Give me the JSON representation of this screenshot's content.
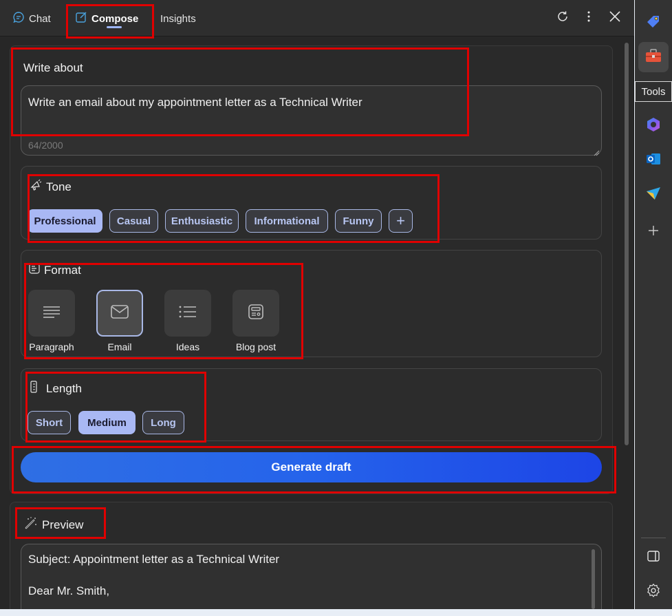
{
  "header": {
    "tabs": [
      {
        "label": "Chat",
        "icon": "chat-icon",
        "active": false
      },
      {
        "label": "Compose",
        "icon": "compose-icon",
        "active": true
      },
      {
        "label": "Insights",
        "icon": null,
        "active": false
      }
    ],
    "actions": [
      "refresh-icon",
      "more-options-icon",
      "close-icon"
    ]
  },
  "write_about": {
    "label": "Write about",
    "value": "Write an email about my appointment letter as a Technical Writer",
    "counter": "64/2000"
  },
  "tone": {
    "title": "Tone",
    "options": [
      {
        "label": "Professional",
        "selected": true
      },
      {
        "label": "Casual",
        "selected": false
      },
      {
        "label": "Enthusiastic",
        "selected": false
      },
      {
        "label": "Informational",
        "selected": false
      },
      {
        "label": "Funny",
        "selected": false
      }
    ],
    "add_label": "+"
  },
  "format": {
    "title": "Format",
    "options": [
      {
        "label": "Paragraph",
        "icon": "paragraph-icon",
        "selected": false
      },
      {
        "label": "Email",
        "icon": "email-icon",
        "selected": true
      },
      {
        "label": "Ideas",
        "icon": "list-icon",
        "selected": false
      },
      {
        "label": "Blog post",
        "icon": "blog-post-icon",
        "selected": false
      }
    ]
  },
  "length": {
    "title": "Length",
    "options": [
      {
        "label": "Short",
        "selected": false
      },
      {
        "label": "Medium",
        "selected": true
      },
      {
        "label": "Long",
        "selected": false
      }
    ]
  },
  "generate_label": "Generate draft",
  "preview": {
    "title": "Preview",
    "lines": [
      "Subject: Appointment letter as a Technical Writer",
      "Dear Mr. Smith,"
    ]
  },
  "sidebar": {
    "items": [
      "tag-icon",
      "tools-icon",
      "copilot-icon",
      "outlook-icon",
      "send-icon",
      "add-icon"
    ],
    "tooltip": "Tools",
    "bottom": [
      "sidebar-toggle-icon",
      "settings-icon"
    ]
  },
  "colors": {
    "accent": "#a9b8f4",
    "primary_button": "#2563eb",
    "annotation": "#e00000"
  }
}
